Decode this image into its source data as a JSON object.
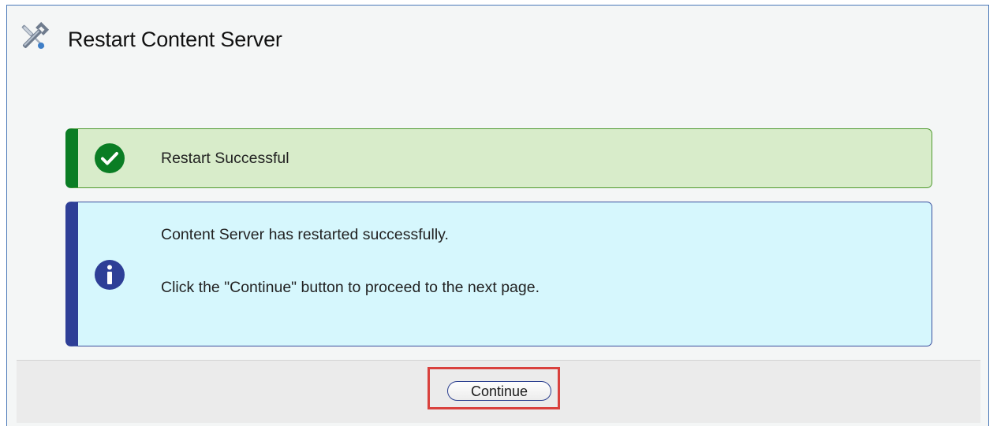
{
  "header": {
    "title": "Restart Content Server",
    "icon": "tools-icon"
  },
  "success_alert": {
    "message": "Restart Successful",
    "icon": "checkmark-circle-icon",
    "accent_color": "#0a7d24",
    "background_color": "#d8ecca"
  },
  "info_alert": {
    "line1": "Content Server has restarted successfully.",
    "line2": "Click the \"Continue\" button to proceed to the next page.",
    "icon": "info-circle-icon",
    "accent_color": "#2e3f97",
    "background_color": "#d6f7fd"
  },
  "footer": {
    "continue_label": "Continue",
    "highlight_color": "#d9413d"
  }
}
